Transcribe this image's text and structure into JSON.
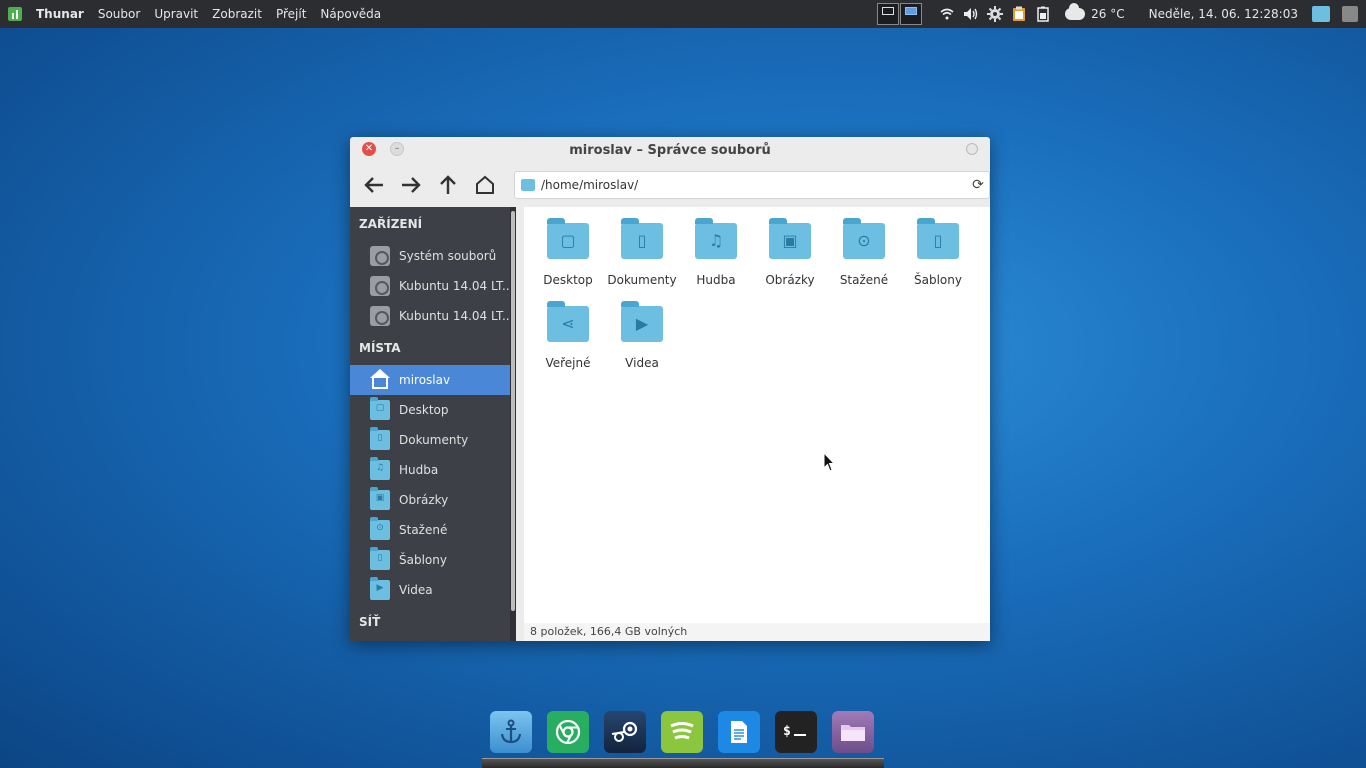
{
  "panel": {
    "menu": [
      "Thunar",
      "Soubor",
      "Upravit",
      "Zobrazit",
      "Přejít",
      "Nápověda"
    ],
    "temperature": "26 °C",
    "clock": "Neděle, 14. 06. 12:28:03"
  },
  "window": {
    "title": "miroslav – Správce souborů",
    "location": "/home/miroslav/",
    "status": "8 položek, 166,4 GB volných"
  },
  "sidebar": {
    "devices_heading": "ZAŘÍZENÍ",
    "devices": [
      "Systém souborů",
      "Kubuntu 14.04 LT...",
      "Kubuntu 14.04 LT..."
    ],
    "places_heading": "MÍSTA",
    "places": [
      "miroslav",
      "Desktop",
      "Dokumenty",
      "Hudba",
      "Obrázky",
      "Stažené",
      "Šablony",
      "Videa"
    ],
    "network_heading": "SÍŤ"
  },
  "files": [
    "Desktop",
    "Dokumenty",
    "Hudba",
    "Obrázky",
    "Stažené",
    "Šablony",
    "Veřejné",
    "Videa"
  ],
  "icons": {
    "places": [
      "home-icon",
      "folder-desktop-icon",
      "folder-documents-icon",
      "folder-music-icon",
      "folder-pictures-icon",
      "folder-download-icon",
      "folder-templates-icon",
      "folder-videos-icon"
    ],
    "dock": [
      "anchor-icon",
      "chrome-icon",
      "steam-icon",
      "spotify-icon",
      "text-editor-icon",
      "terminal-icon",
      "files-icon"
    ]
  },
  "colors": {
    "accent": "#4a87d6",
    "folder": "#6dbfe2",
    "sidebar": "#3d4046",
    "panel": "#2b2d31"
  }
}
